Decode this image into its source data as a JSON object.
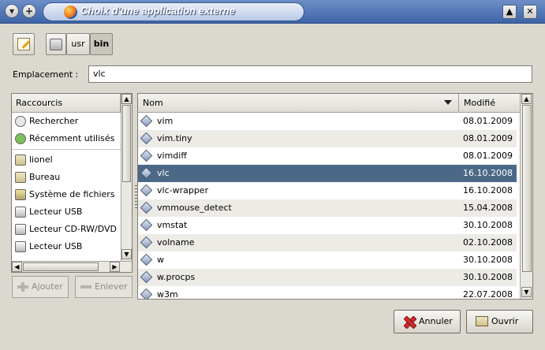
{
  "window": {
    "title": "Choix d'une application externe",
    "menu_glyph": "▾",
    "add_glyph": "+",
    "shade_glyph": "▲",
    "close_glyph": "✕"
  },
  "path_bar": {
    "segments": [
      "usr",
      "bin"
    ]
  },
  "location": {
    "label": "Emplacement :",
    "value": "vlc"
  },
  "places": {
    "header": "Raccourcis",
    "items": [
      {
        "label": "Rechercher",
        "icon": "search-icon"
      },
      {
        "label": "Récemment utilisés",
        "icon": "recent-icon"
      },
      {
        "label": "lionel",
        "icon": "folder-icon"
      },
      {
        "label": "Bureau",
        "icon": "folder-icon"
      },
      {
        "label": "Système de fichiers",
        "icon": "filesystem-icon"
      },
      {
        "label": "Lecteur USB",
        "icon": "drive-icon"
      },
      {
        "label": "Lecteur CD-RW/DVD",
        "icon": "drive-icon"
      },
      {
        "label": "Lecteur USB",
        "icon": "drive-icon"
      }
    ],
    "add_label": "Ajouter",
    "remove_label": "Enlever"
  },
  "files": {
    "col_name": "Nom",
    "col_modified": "Modifié",
    "rows": [
      {
        "name": "vim",
        "date": "08.01.2009"
      },
      {
        "name": "vim.tiny",
        "date": "08.01.2009"
      },
      {
        "name": "vimdiff",
        "date": "08.01.2009"
      },
      {
        "name": "vlc",
        "date": "16.10.2008",
        "selected": true
      },
      {
        "name": "vlc-wrapper",
        "date": "16.10.2008"
      },
      {
        "name": "vmmouse_detect",
        "date": "15.04.2008"
      },
      {
        "name": "vmstat",
        "date": "30.10.2008"
      },
      {
        "name": "volname",
        "date": "02.10.2008"
      },
      {
        "name": "w",
        "date": "30.10.2008"
      },
      {
        "name": "w.procps",
        "date": "30.10.2008"
      },
      {
        "name": "w3m",
        "date": "22.07.2008"
      }
    ]
  },
  "actions": {
    "cancel_label": "Annuler",
    "open_label": "Ouvrir"
  },
  "colors": {
    "selection": "#4b6987",
    "titlebar": "#3d64a8"
  }
}
